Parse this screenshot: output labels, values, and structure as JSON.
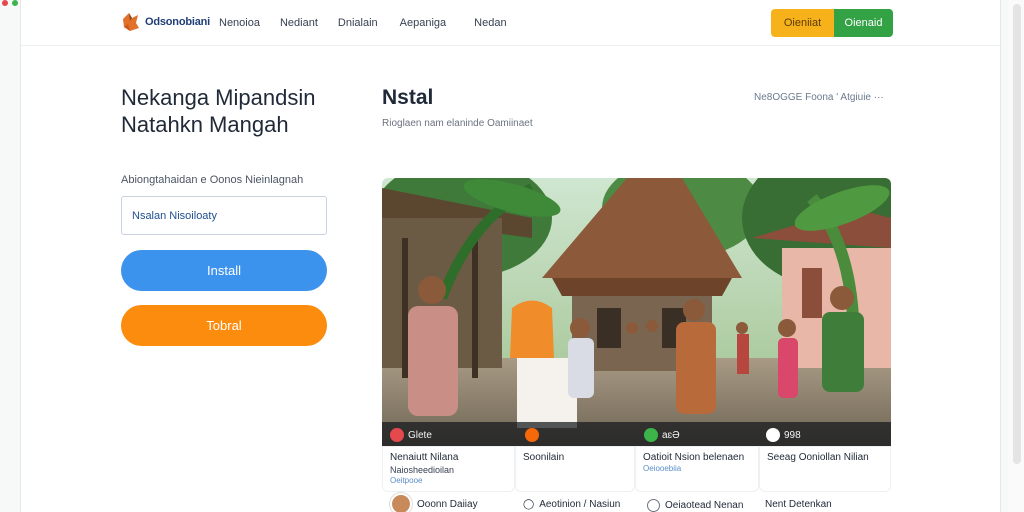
{
  "brand": {
    "name": "Odsonobiani"
  },
  "nav": {
    "items": [
      "Nenoioa",
      "Nediant",
      "Dnialain",
      "Aepaniga",
      "Nedan"
    ],
    "cta_primary": "Oieniiat",
    "cta_secondary": "Oienaid"
  },
  "hero": {
    "title": "Nekanga Mipandsin Natahkn Mangah",
    "form_label": "Abiongtahaidan e Oonos Nieinlagnah",
    "input_value": "Nsalan Nisoiloaty",
    "install_label": "Install",
    "secondary_label": "Tobral"
  },
  "section": {
    "title": "Nstal",
    "subtitle": "Rioglaen nam elaninde Oamiinaet",
    "link": "Ne8OGGE Foona ' Atgiuie ···"
  },
  "photo": {
    "badges": [
      {
        "icon": "heart-icon",
        "text": "Glete",
        "color": "#e5484d"
      },
      {
        "icon": "flame-icon",
        "text": "",
        "color": "#f76808"
      },
      {
        "icon": "check-icon",
        "text": "aɛƏ",
        "color": "#3cb44a"
      },
      {
        "icon": "heart-outline-icon",
        "text": "998",
        "color": "#ffffff"
      }
    ]
  },
  "cards": [
    {
      "title": "Nenaiutt Nilana",
      "line2": "Naiosheedioilan",
      "line3": "Oeitpooe"
    },
    {
      "title": "Soonilain",
      "line2": "",
      "line3": ""
    },
    {
      "title": "Oatioit Nsion belenaen",
      "line2": "Oeiooebiia",
      "line3": ""
    },
    {
      "title": "Seeag Ooniollan Nilian",
      "line2": "",
      "line3": ""
    }
  ],
  "bottom": [
    {
      "icon": "avatar",
      "text": "Ooonn Daiiay"
    },
    {
      "icon": "chat-icon",
      "text": "Aeotinion / Nasiun"
    },
    {
      "icon": "ring-icon",
      "text": "Oeiaotead Nenan"
    },
    {
      "icon": "",
      "text": "Nent Detenkan"
    }
  ],
  "colors": {
    "accent_blue": "#3b93ee",
    "accent_orange": "#fb8c0e",
    "nav_yellow": "#f7b21b",
    "nav_green": "#33a245"
  }
}
